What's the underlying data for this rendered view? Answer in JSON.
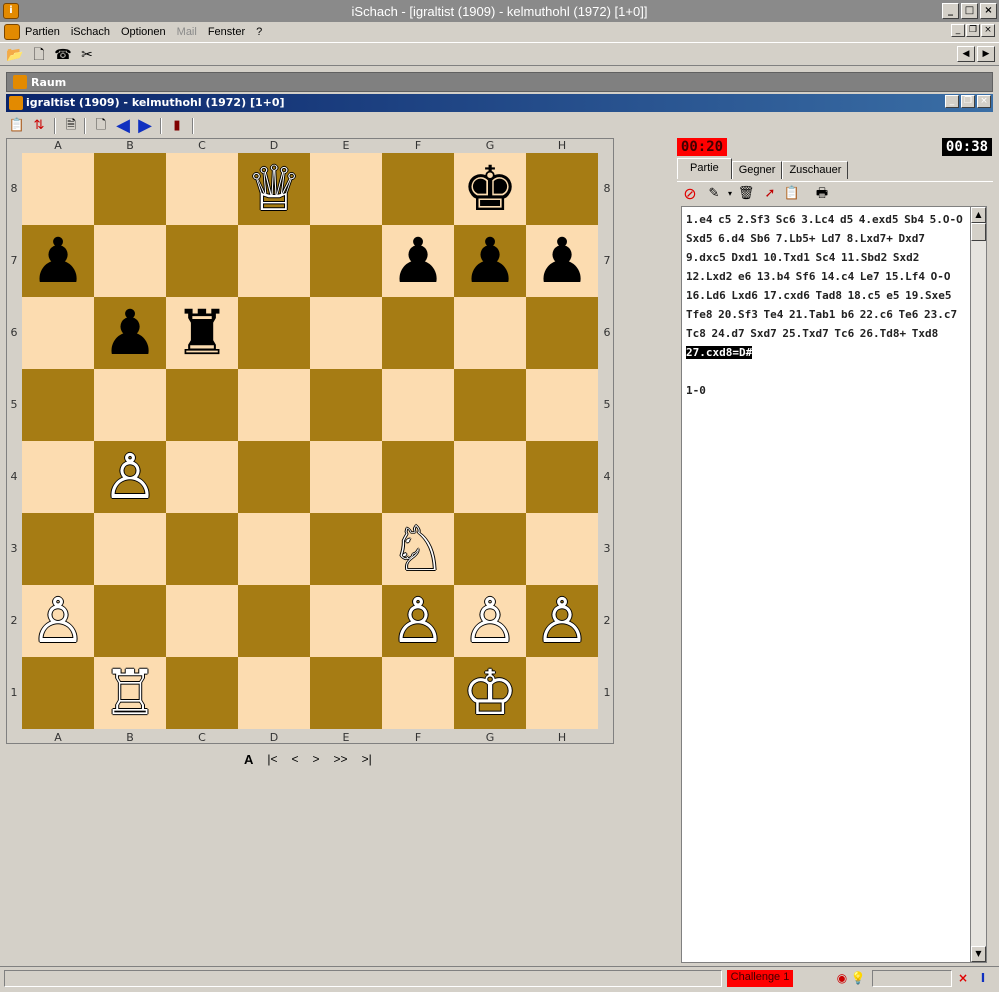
{
  "window": {
    "title": "iSchach - [igraltist (1909) - kelmuthohl (1972)   [1+0]]"
  },
  "menu": {
    "items": [
      "Partien",
      "iSchach",
      "Optionen",
      "Mail",
      "Fenster",
      "?"
    ]
  },
  "raum": {
    "label": "Raum"
  },
  "game": {
    "title": "igraltist (1909) - kelmuthohl (1972)   [1+0]"
  },
  "board": {
    "files": [
      "A",
      "B",
      "C",
      "D",
      "E",
      "F",
      "G",
      "H"
    ],
    "ranks": [
      "8",
      "7",
      "6",
      "5",
      "4",
      "3",
      "2",
      "1"
    ],
    "rows": [
      [
        "",
        "",
        "",
        "♕",
        "",
        "",
        "♚",
        ""
      ],
      [
        "♟",
        "",
        "",
        "",
        "",
        "♟",
        "♟",
        "♟"
      ],
      [
        "",
        "♟",
        "♜",
        "",
        "",
        "",
        "",
        ""
      ],
      [
        "",
        "",
        "",
        "",
        "",
        "",
        "",
        ""
      ],
      [
        "",
        "♙",
        "",
        "",
        "",
        "",
        "",
        ""
      ],
      [
        "",
        "",
        "",
        "",
        "",
        "♘",
        "",
        ""
      ],
      [
        "♙",
        "",
        "",
        "",
        "",
        "♙",
        "♙",
        "♙"
      ],
      [
        "",
        "♖",
        "",
        "",
        "",
        "",
        "♔",
        ""
      ]
    ]
  },
  "nav": {
    "a": "A",
    "first": "|<",
    "prev": "<",
    "next": ">",
    "fast": ">>",
    "last": ">|"
  },
  "clocks": {
    "white": "00:20",
    "black": "00:38"
  },
  "tabs": [
    "Partie",
    "Gegner",
    "Zuschauer"
  ],
  "notation": {
    "lines": [
      "1.e4 c5 2.Sf3 Sc6 3.Lc4 d5 4.exd5 Sb4 5.O-O",
      "Sxd5 6.d4 Sb6 7.Lb5+ Ld7 8.Lxd7+ Dxd7",
      "9.dxc5 Dxd1 10.Txd1 Sc4 11.Sbd2 Sxd2",
      "12.Lxd2 e6 13.b4 Sf6 14.c4 Le7 15.Lf4 O-O",
      "16.Ld6 Lxd6 17.cxd6 Tad8 18.c5 e5 19.Sxe5",
      "Tfe8 20.Sf3 Te4 21.Tab1 b6 22.c6 Te6 23.c7",
      "Tc8 24.d7 Sxd7 25.Txd7 Tc6 26.Td8+ Txd8"
    ],
    "current_move": "27.cxd8=D#",
    "result": "1-0"
  },
  "status": {
    "challenge": "Challenge 1"
  }
}
